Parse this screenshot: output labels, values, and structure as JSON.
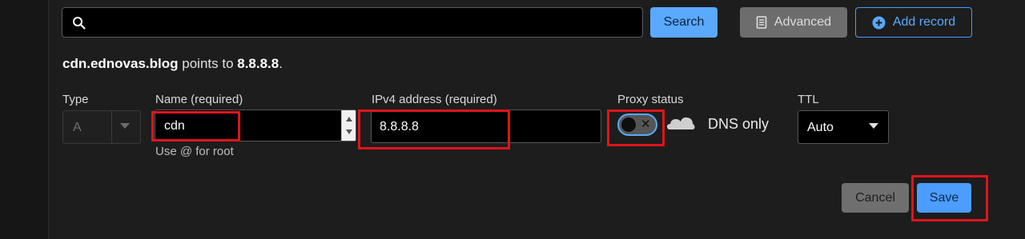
{
  "toolbar": {
    "search_value": "",
    "search_label": "Search",
    "advanced_label": "Advanced",
    "add_record_label": "Add record"
  },
  "summary": {
    "host": "cdn.ednovas.blog",
    "middle": " points to ",
    "target": "8.8.8.8",
    "end": "."
  },
  "form": {
    "type_label": "Type",
    "type_value": "A",
    "name_label": "Name (required)",
    "name_value": "cdn",
    "name_hint": "Use @ for root",
    "ipv4_label": "IPv4 address (required)",
    "ipv4_value": "8.8.8.8",
    "proxy_label": "Proxy status",
    "proxy_on": false,
    "proxy_text": "DNS only",
    "ttl_label": "TTL",
    "ttl_value": "Auto"
  },
  "actions": {
    "cancel_label": "Cancel",
    "save_label": "Save"
  },
  "icons": {
    "search": "search-icon",
    "advanced": "document-icon",
    "add": "plus-circle-icon",
    "proxy": "cloud-icon"
  },
  "colors": {
    "accent": "#5aa9ff",
    "highlight": "#e0141c"
  }
}
